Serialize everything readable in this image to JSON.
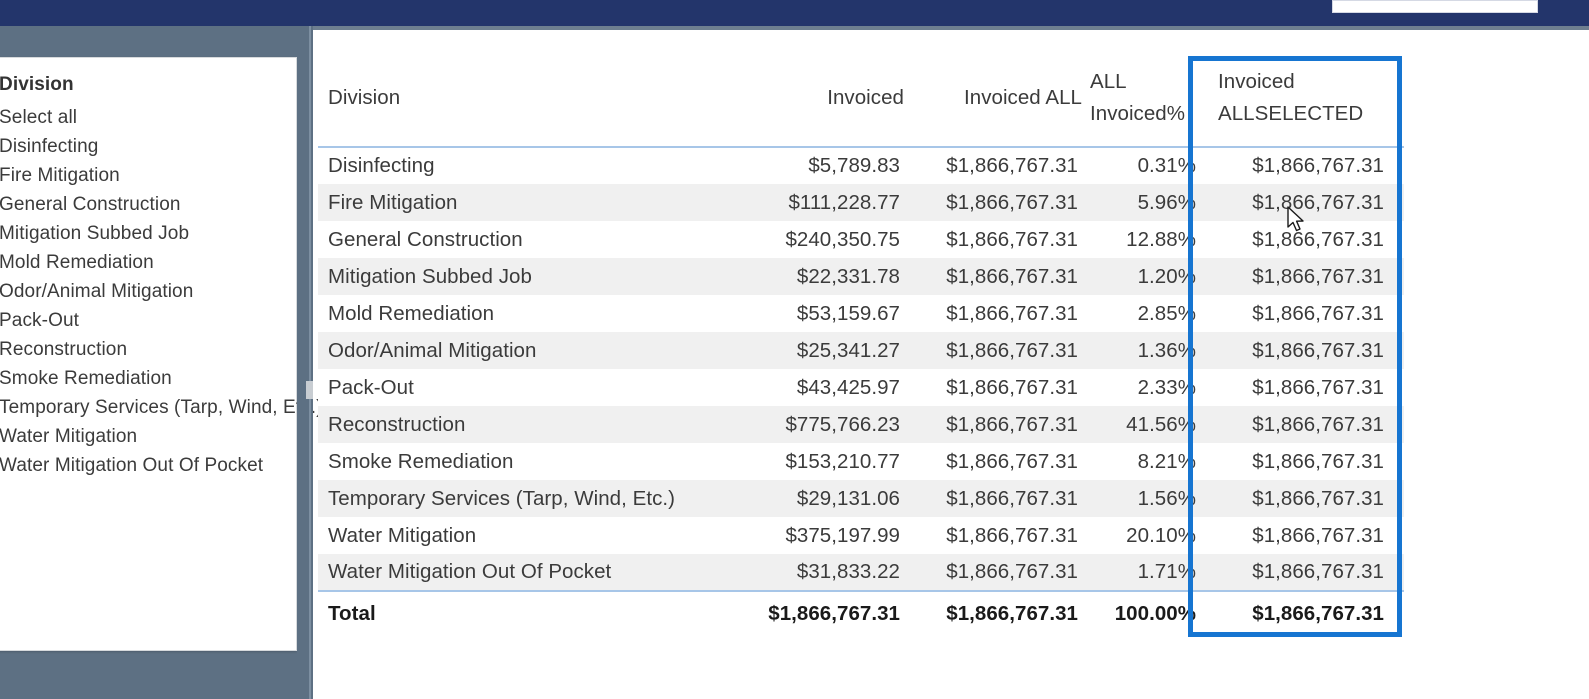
{
  "window": {
    "top_bar_color": "#23356b",
    "canvas_color": "#5d7083",
    "highlight_color": "#1675d1"
  },
  "slicer": {
    "title": "Division",
    "items": [
      {
        "label": "Select all"
      },
      {
        "label": "Disinfecting"
      },
      {
        "label": "Fire Mitigation"
      },
      {
        "label": "General Construction"
      },
      {
        "label": "Mitigation Subbed Job"
      },
      {
        "label": "Mold Remediation"
      },
      {
        "label": "Odor/Animal Mitigation"
      },
      {
        "label": "Pack-Out"
      },
      {
        "label": "Reconstruction"
      },
      {
        "label": "Smoke Remediation"
      },
      {
        "label": "Temporary Services (Tarp, Wind, Etc.)"
      },
      {
        "label": "Water Mitigation"
      },
      {
        "label": "Water Mitigation Out Of Pocket"
      }
    ]
  },
  "matrix": {
    "columns": [
      {
        "label": "Division"
      },
      {
        "label": "Invoiced"
      },
      {
        "label": "Invoiced ALL"
      },
      {
        "label": "ALL Invoiced%"
      },
      {
        "label": "Invoiced ALLSELECTED"
      }
    ],
    "rows": [
      {
        "division": "Disinfecting",
        "invoiced": "$5,789.83",
        "invoiced_all": "$1,866,767.31",
        "all_invoiced_pct": "0.31%",
        "invoiced_allselected": "$1,866,767.31"
      },
      {
        "division": "Fire Mitigation",
        "invoiced": "$111,228.77",
        "invoiced_all": "$1,866,767.31",
        "all_invoiced_pct": "5.96%",
        "invoiced_allselected": "$1,866,767.31"
      },
      {
        "division": "General Construction",
        "invoiced": "$240,350.75",
        "invoiced_all": "$1,866,767.31",
        "all_invoiced_pct": "12.88%",
        "invoiced_allselected": "$1,866,767.31"
      },
      {
        "division": "Mitigation Subbed Job",
        "invoiced": "$22,331.78",
        "invoiced_all": "$1,866,767.31",
        "all_invoiced_pct": "1.20%",
        "invoiced_allselected": "$1,866,767.31"
      },
      {
        "division": "Mold Remediation",
        "invoiced": "$53,159.67",
        "invoiced_all": "$1,866,767.31",
        "all_invoiced_pct": "2.85%",
        "invoiced_allselected": "$1,866,767.31"
      },
      {
        "division": "Odor/Animal Mitigation",
        "invoiced": "$25,341.27",
        "invoiced_all": "$1,866,767.31",
        "all_invoiced_pct": "1.36%",
        "invoiced_allselected": "$1,866,767.31"
      },
      {
        "division": "Pack-Out",
        "invoiced": "$43,425.97",
        "invoiced_all": "$1,866,767.31",
        "all_invoiced_pct": "2.33%",
        "invoiced_allselected": "$1,866,767.31"
      },
      {
        "division": "Reconstruction",
        "invoiced": "$775,766.23",
        "invoiced_all": "$1,866,767.31",
        "all_invoiced_pct": "41.56%",
        "invoiced_allselected": "$1,866,767.31"
      },
      {
        "division": "Smoke Remediation",
        "invoiced": "$153,210.77",
        "invoiced_all": "$1,866,767.31",
        "all_invoiced_pct": "8.21%",
        "invoiced_allselected": "$1,866,767.31"
      },
      {
        "division": "Temporary Services (Tarp, Wind, Etc.)",
        "invoiced": "$29,131.06",
        "invoiced_all": "$1,866,767.31",
        "all_invoiced_pct": "1.56%",
        "invoiced_allselected": "$1,866,767.31"
      },
      {
        "division": "Water Mitigation",
        "invoiced": "$375,197.99",
        "invoiced_all": "$1,866,767.31",
        "all_invoiced_pct": "20.10%",
        "invoiced_allselected": "$1,866,767.31"
      },
      {
        "division": "Water Mitigation Out Of Pocket",
        "invoiced": "$31,833.22",
        "invoiced_all": "$1,866,767.31",
        "all_invoiced_pct": "1.71%",
        "invoiced_allselected": "$1,866,767.31"
      }
    ],
    "total": {
      "division": "Total",
      "invoiced": "$1,866,767.31",
      "invoiced_all": "$1,866,767.31",
      "all_invoiced_pct": "100.00%",
      "invoiced_allselected": "$1,866,767.31"
    }
  }
}
